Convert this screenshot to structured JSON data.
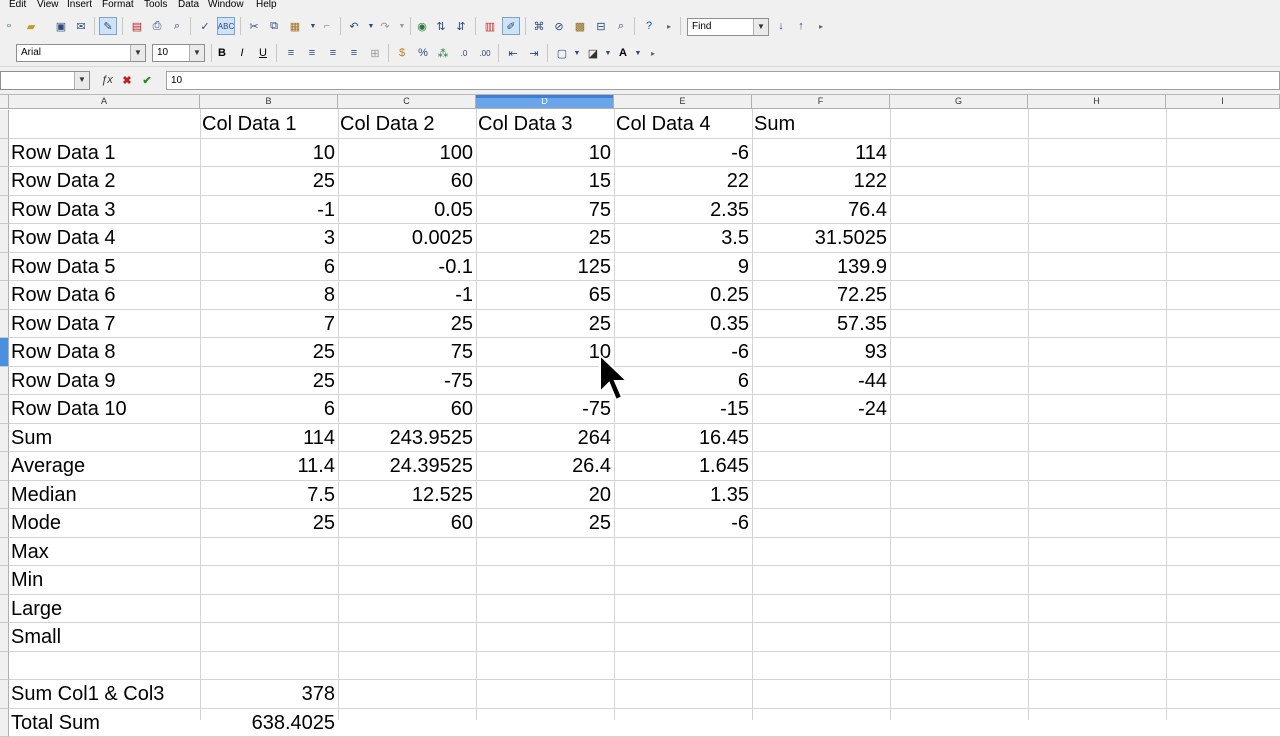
{
  "menu": [
    "Edit",
    "View",
    "Insert",
    "Format",
    "Tools",
    "Data",
    "Window",
    "Help"
  ],
  "toolbar": {
    "find_placeholder": "Find",
    "font_name": "Arial",
    "font_size": "10",
    "bold": "B",
    "italic": "I",
    "underline": "U"
  },
  "formula_bar": {
    "name_box": "",
    "content": "10"
  },
  "columns": [
    "A",
    "B",
    "C",
    "D",
    "E",
    "F",
    "G",
    "H",
    "I"
  ],
  "selected_column": "D",
  "selected_row_index": 8,
  "rows": [
    [
      "",
      "Col Data 1",
      "Col Data 2",
      "Col Data 3",
      "Col Data 4",
      "Sum"
    ],
    [
      "Row Data 1",
      "10",
      "100",
      "10",
      "-6",
      "114"
    ],
    [
      "Row Data 2",
      "25",
      "60",
      "15",
      "22",
      "122"
    ],
    [
      "Row Data 3",
      "-1",
      "0.05",
      "75",
      "2.35",
      "76.4"
    ],
    [
      "Row Data 4",
      "3",
      "0.0025",
      "25",
      "3.5",
      "31.5025"
    ],
    [
      "Row Data 5",
      "6",
      "-0.1",
      "125",
      "9",
      "139.9"
    ],
    [
      "Row Data 6",
      "8",
      "-1",
      "65",
      "0.25",
      "72.25"
    ],
    [
      "Row Data 7",
      "7",
      "25",
      "25",
      "0.35",
      "57.35"
    ],
    [
      "Row Data 8",
      "25",
      "75",
      "10",
      "-6",
      "93"
    ],
    [
      "Row Data 9",
      "25",
      "-75",
      "",
      "6",
      "-44"
    ],
    [
      "Row Data 10",
      "6",
      "60",
      "-75",
      "-15",
      "-24"
    ],
    [
      "Sum",
      "114",
      "243.9525",
      "264",
      "16.45",
      ""
    ],
    [
      "Average",
      "11.4",
      "24.39525",
      "26.4",
      "1.645",
      ""
    ],
    [
      "Median",
      "7.5",
      "12.525",
      "20",
      "1.35",
      ""
    ],
    [
      "Mode",
      "25",
      "60",
      "25",
      "-6",
      ""
    ],
    [
      "Max",
      "",
      "",
      "",
      "",
      ""
    ],
    [
      "Min",
      "",
      "",
      "",
      "",
      ""
    ],
    [
      "Large",
      "",
      "",
      "",
      "",
      ""
    ],
    [
      "Small",
      "",
      "",
      "",
      "",
      ""
    ],
    [
      "",
      "",
      "",
      "",
      "",
      ""
    ],
    [
      "Sum Col1 & Col3",
      "378",
      "",
      "",
      "",
      ""
    ],
    [
      "Total Sum",
      "638.4025",
      "",
      "",
      "",
      ""
    ]
  ]
}
